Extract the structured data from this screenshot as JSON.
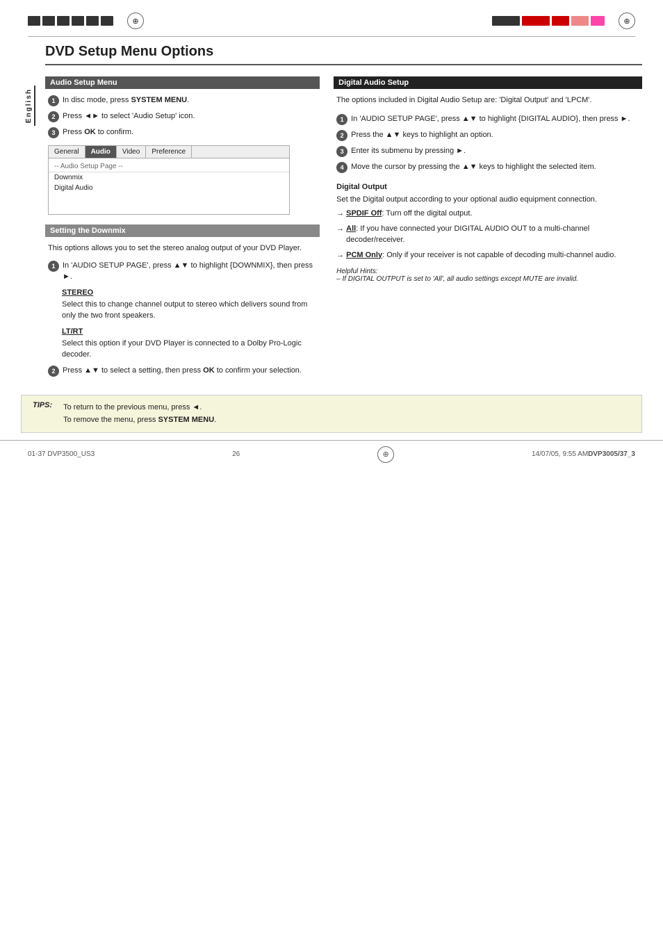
{
  "page": {
    "title": "DVD Setup Menu Options",
    "number": "26",
    "file_ref_left": "01-37 DVP3500_US3",
    "file_ref_right": "DVP3005/37_3",
    "file_date": "14/07/05, 9:55 AM",
    "page_center": "26"
  },
  "sidebar": {
    "label": "English"
  },
  "audio_setup": {
    "header": "Audio Setup Menu",
    "steps": [
      {
        "num": "1",
        "text": "In disc mode, press ",
        "bold": "SYSTEM MENU",
        "after": "."
      },
      {
        "num": "2",
        "text": "Press ",
        "bold": "◄►",
        "after": " to select 'Audio Setup' icon."
      },
      {
        "num": "3",
        "text": "Press ",
        "bold": "OK",
        "after": " to confirm."
      }
    ],
    "menu_tabs": [
      "General",
      "Audio",
      "Video",
      "Preference"
    ],
    "menu_active_tab": "Audio",
    "menu_row_label": "-- Audio Setup Page --",
    "menu_items": [
      "Downmix",
      "Digital Audio"
    ]
  },
  "setting_downmix": {
    "header": "Setting the Downmix",
    "intro": "This options allows you to set the stereo analog output of your DVD Player.",
    "step1_text": "In 'AUDIO SETUP PAGE', press ▲▼ to highlight {DOWNMIX}, then press ►.",
    "stereo_label": "STEREO",
    "stereo_text": "Select this to change channel output to stereo which delivers sound from only the two front speakers.",
    "ltrt_label": "LT/RT",
    "ltrt_text": "Select this option if your DVD Player is connected to a Dolby Pro-Logic decoder.",
    "step2_text": "Press ▲▼ to select a setting, then press ",
    "step2_bold": "OK",
    "step2_after": " to confirm your selection."
  },
  "digital_audio_setup": {
    "header": "Digital Audio Setup",
    "intro": "The options included in Digital Audio Setup are: 'Digital Output' and 'LPCM'.",
    "steps": [
      {
        "num": "1",
        "text": "In 'AUDIO SETUP PAGE', press ▲▼ to highlight {DIGITAL AUDIO}, then press ►."
      },
      {
        "num": "2",
        "text": "Press the ▲▼ keys to highlight an option."
      },
      {
        "num": "3",
        "text": "Enter its submenu by pressing ►."
      },
      {
        "num": "4",
        "text": "Move the cursor by pressing the ▲▼ keys to highlight the selected item."
      }
    ],
    "digital_output_label": "Digital Output",
    "digital_output_intro": "Set the Digital output according to your optional audio equipment connection.",
    "spdif_label": "SPDIF Off",
    "spdif_text": "Turn off the digital output.",
    "all_label": "All",
    "all_text": "If you have connected your DIGITAL AUDIO OUT to a multi-channel decoder/receiver.",
    "pcm_label": "PCM Only",
    "pcm_text": "Only if your receiver is not capable of decoding multi-channel audio.",
    "helpful_hints_label": "Helpful Hints:",
    "helpful_hints_text": "–   If DIGITAL OUTPUT is set to 'All', all audio settings except MUTE are invalid."
  },
  "tips": {
    "label": "TIPS:",
    "line1": "To return to the previous menu, press ◄.",
    "line2": "To remove the menu, press ",
    "line2_bold": "SYSTEM MENU",
    "line2_after": "."
  }
}
